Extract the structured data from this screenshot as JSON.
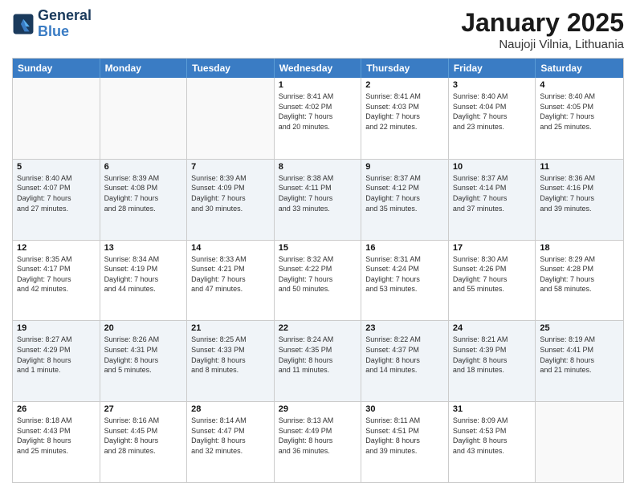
{
  "header": {
    "logo_line1": "General",
    "logo_line2": "Blue",
    "month": "January 2025",
    "location": "Naujoji Vilnia, Lithuania"
  },
  "weekdays": [
    "Sunday",
    "Monday",
    "Tuesday",
    "Wednesday",
    "Thursday",
    "Friday",
    "Saturday"
  ],
  "rows": [
    {
      "cells": [
        {
          "day": "",
          "text": ""
        },
        {
          "day": "",
          "text": ""
        },
        {
          "day": "",
          "text": ""
        },
        {
          "day": "1",
          "text": "Sunrise: 8:41 AM\nSunset: 4:02 PM\nDaylight: 7 hours\nand 20 minutes."
        },
        {
          "day": "2",
          "text": "Sunrise: 8:41 AM\nSunset: 4:03 PM\nDaylight: 7 hours\nand 22 minutes."
        },
        {
          "day": "3",
          "text": "Sunrise: 8:40 AM\nSunset: 4:04 PM\nDaylight: 7 hours\nand 23 minutes."
        },
        {
          "day": "4",
          "text": "Sunrise: 8:40 AM\nSunset: 4:05 PM\nDaylight: 7 hours\nand 25 minutes."
        }
      ]
    },
    {
      "cells": [
        {
          "day": "5",
          "text": "Sunrise: 8:40 AM\nSunset: 4:07 PM\nDaylight: 7 hours\nand 27 minutes."
        },
        {
          "day": "6",
          "text": "Sunrise: 8:39 AM\nSunset: 4:08 PM\nDaylight: 7 hours\nand 28 minutes."
        },
        {
          "day": "7",
          "text": "Sunrise: 8:39 AM\nSunset: 4:09 PM\nDaylight: 7 hours\nand 30 minutes."
        },
        {
          "day": "8",
          "text": "Sunrise: 8:38 AM\nSunset: 4:11 PM\nDaylight: 7 hours\nand 33 minutes."
        },
        {
          "day": "9",
          "text": "Sunrise: 8:37 AM\nSunset: 4:12 PM\nDaylight: 7 hours\nand 35 minutes."
        },
        {
          "day": "10",
          "text": "Sunrise: 8:37 AM\nSunset: 4:14 PM\nDaylight: 7 hours\nand 37 minutes."
        },
        {
          "day": "11",
          "text": "Sunrise: 8:36 AM\nSunset: 4:16 PM\nDaylight: 7 hours\nand 39 minutes."
        }
      ]
    },
    {
      "cells": [
        {
          "day": "12",
          "text": "Sunrise: 8:35 AM\nSunset: 4:17 PM\nDaylight: 7 hours\nand 42 minutes."
        },
        {
          "day": "13",
          "text": "Sunrise: 8:34 AM\nSunset: 4:19 PM\nDaylight: 7 hours\nand 44 minutes."
        },
        {
          "day": "14",
          "text": "Sunrise: 8:33 AM\nSunset: 4:21 PM\nDaylight: 7 hours\nand 47 minutes."
        },
        {
          "day": "15",
          "text": "Sunrise: 8:32 AM\nSunset: 4:22 PM\nDaylight: 7 hours\nand 50 minutes."
        },
        {
          "day": "16",
          "text": "Sunrise: 8:31 AM\nSunset: 4:24 PM\nDaylight: 7 hours\nand 53 minutes."
        },
        {
          "day": "17",
          "text": "Sunrise: 8:30 AM\nSunset: 4:26 PM\nDaylight: 7 hours\nand 55 minutes."
        },
        {
          "day": "18",
          "text": "Sunrise: 8:29 AM\nSunset: 4:28 PM\nDaylight: 7 hours\nand 58 minutes."
        }
      ]
    },
    {
      "cells": [
        {
          "day": "19",
          "text": "Sunrise: 8:27 AM\nSunset: 4:29 PM\nDaylight: 8 hours\nand 1 minute."
        },
        {
          "day": "20",
          "text": "Sunrise: 8:26 AM\nSunset: 4:31 PM\nDaylight: 8 hours\nand 5 minutes."
        },
        {
          "day": "21",
          "text": "Sunrise: 8:25 AM\nSunset: 4:33 PM\nDaylight: 8 hours\nand 8 minutes."
        },
        {
          "day": "22",
          "text": "Sunrise: 8:24 AM\nSunset: 4:35 PM\nDaylight: 8 hours\nand 11 minutes."
        },
        {
          "day": "23",
          "text": "Sunrise: 8:22 AM\nSunset: 4:37 PM\nDaylight: 8 hours\nand 14 minutes."
        },
        {
          "day": "24",
          "text": "Sunrise: 8:21 AM\nSunset: 4:39 PM\nDaylight: 8 hours\nand 18 minutes."
        },
        {
          "day": "25",
          "text": "Sunrise: 8:19 AM\nSunset: 4:41 PM\nDaylight: 8 hours\nand 21 minutes."
        }
      ]
    },
    {
      "cells": [
        {
          "day": "26",
          "text": "Sunrise: 8:18 AM\nSunset: 4:43 PM\nDaylight: 8 hours\nand 25 minutes."
        },
        {
          "day": "27",
          "text": "Sunrise: 8:16 AM\nSunset: 4:45 PM\nDaylight: 8 hours\nand 28 minutes."
        },
        {
          "day": "28",
          "text": "Sunrise: 8:14 AM\nSunset: 4:47 PM\nDaylight: 8 hours\nand 32 minutes."
        },
        {
          "day": "29",
          "text": "Sunrise: 8:13 AM\nSunset: 4:49 PM\nDaylight: 8 hours\nand 36 minutes."
        },
        {
          "day": "30",
          "text": "Sunrise: 8:11 AM\nSunset: 4:51 PM\nDaylight: 8 hours\nand 39 minutes."
        },
        {
          "day": "31",
          "text": "Sunrise: 8:09 AM\nSunset: 4:53 PM\nDaylight: 8 hours\nand 43 minutes."
        },
        {
          "day": "",
          "text": ""
        }
      ]
    }
  ]
}
